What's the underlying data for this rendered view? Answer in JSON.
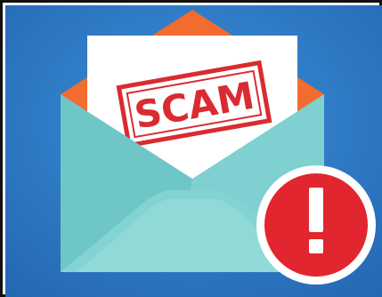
{
  "illustration": {
    "stamp_text": "SCAM",
    "alert_glyph": "!",
    "icon_names": [
      "envelope-icon",
      "letter-icon",
      "alert-icon"
    ],
    "colors": {
      "background": "#2a78c5",
      "background_light": "#3a8fd8",
      "envelope_front": "#7ed1d0",
      "envelope_flap_inner": "#55b7b6",
      "envelope_back": "#f26b2f",
      "letter": "#ffffff",
      "stamp": "#d92b31",
      "alert_circle": "#e1262f",
      "alert_ring": "#ffffff"
    }
  }
}
